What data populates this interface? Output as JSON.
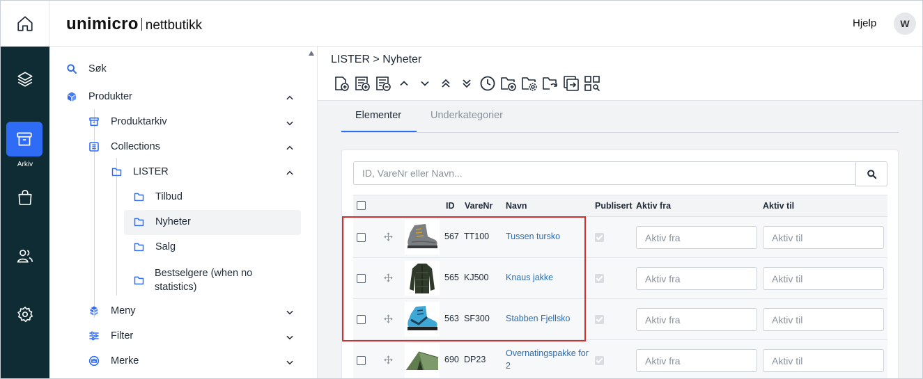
{
  "app": {
    "logo_main": "unimicro",
    "logo_sub": "nettbutikk",
    "help_label": "Hjelp",
    "avatar_initial": "W"
  },
  "rail": {
    "active_label": "Arkiv"
  },
  "tree": {
    "items": [
      {
        "label": "Søk",
        "icon": "search-icon"
      },
      {
        "label": "Produkter",
        "icon": "cube-icon"
      },
      {
        "label": "Produktarkiv",
        "icon": "archive-icon"
      },
      {
        "label": "Collections",
        "icon": "list-icon"
      },
      {
        "label": "LISTER",
        "icon": "folder-icon"
      },
      {
        "label": "Tilbud",
        "icon": "folder-icon"
      },
      {
        "label": "Nyheter",
        "icon": "folder-icon"
      },
      {
        "label": "Salg",
        "icon": "folder-icon"
      },
      {
        "label_line1": "Bestselgere (when no",
        "label_line2": "statistics)",
        "icon": "folder-icon"
      },
      {
        "label": "Meny",
        "icon": "cubes-icon"
      },
      {
        "label": "Filter",
        "icon": "sliders-icon"
      },
      {
        "label": "Merke",
        "icon": "crown-icon"
      }
    ]
  },
  "main": {
    "breadcrumb": "LISTER > Nyheter",
    "tabs": [
      {
        "label": "Elementer",
        "active": true
      },
      {
        "label": "Underkategorier",
        "active": false
      }
    ],
    "search_placeholder": "ID, VareNr eller Navn...",
    "columns": {
      "id": "ID",
      "varenr": "VareNr",
      "navn": "Navn",
      "publisert": "Publisert",
      "aktiv_fra": "Aktiv fra",
      "aktiv_til": "Aktiv til"
    },
    "rows": [
      {
        "id": "567",
        "varenr": "TT100",
        "navn": "Tussen tursko",
        "thumb": "boot-icon",
        "publisert": true
      },
      {
        "id": "565",
        "varenr": "KJ500",
        "navn": "Knaus jakke",
        "thumb": "jacket-icon",
        "publisert": true
      },
      {
        "id": "563",
        "varenr": "SF300",
        "navn": "Stabben Fjellsko",
        "thumb": "blue-boot-icon",
        "publisert": true
      },
      {
        "id": "690",
        "varenr": "DP23",
        "navn_line1": "Overnatingspakke for",
        "navn_line2": "2",
        "thumb": "tent-icon",
        "publisert": true
      }
    ],
    "date_placeholder_from": "Aktiv fra",
    "date_placeholder_to": "Aktiv til"
  },
  "colors": {
    "rail_bg": "#0f2b33",
    "accent": "#2f6cf5",
    "link": "#2b6cb0",
    "highlight": "#d32f2f"
  }
}
